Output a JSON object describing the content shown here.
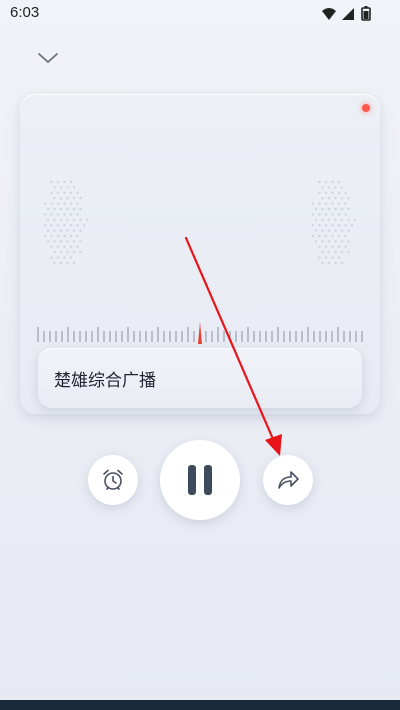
{
  "status_bar": {
    "time": "6:03",
    "icons": [
      "wifi-icon",
      "signal-icon",
      "battery-icon"
    ]
  },
  "header": {
    "collapse_icon": "chevron-down-icon"
  },
  "player": {
    "station_name": "楚雄综合广播",
    "recording_indicator_color": "#ff5a4d",
    "tuner_needle_color": "#e8412f"
  },
  "controls": {
    "alarm_icon": "alarm-clock-icon",
    "play_state_icon": "pause-icon",
    "share_icon": "share-icon"
  },
  "annotation": {
    "color": "#e8141a"
  }
}
